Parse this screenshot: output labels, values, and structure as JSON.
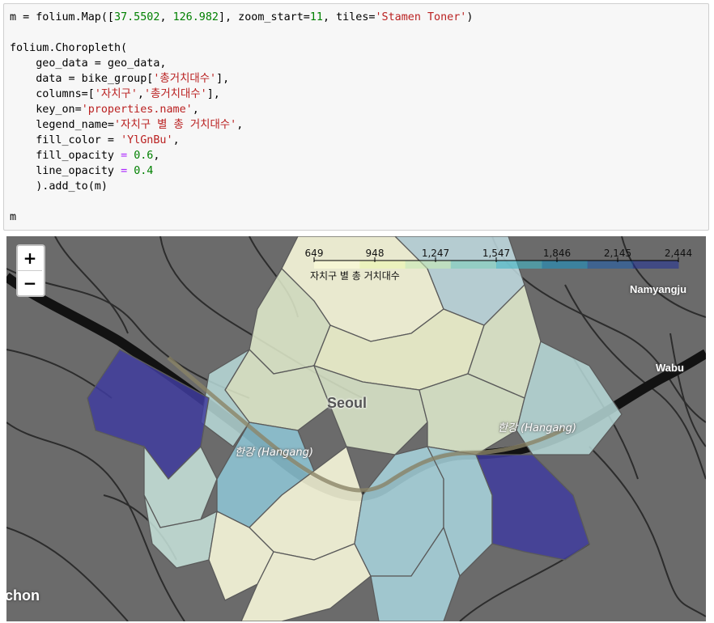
{
  "code_cell": {
    "lines": [
      [
        {
          "t": "m = folium.Map(["
        },
        {
          "t": "37.5502",
          "c": "n"
        },
        {
          "t": ", "
        },
        {
          "t": "126.982",
          "c": "n"
        },
        {
          "t": "], zoom_start="
        },
        {
          "t": "11",
          "c": "n"
        },
        {
          "t": ", tiles="
        },
        {
          "t": "'Stamen Toner'",
          "c": "s"
        },
        {
          "t": ")"
        }
      ],
      [],
      [
        {
          "t": "folium.Choropleth("
        }
      ],
      [
        {
          "t": "    geo_data = geo_data,"
        }
      ],
      [
        {
          "t": "    data = bike_group["
        },
        {
          "t": "'총거치대수'",
          "c": "s"
        },
        {
          "t": "],"
        }
      ],
      [
        {
          "t": "    columns=["
        },
        {
          "t": "'자치구'",
          "c": "s"
        },
        {
          "t": ","
        },
        {
          "t": "'총거치대수'",
          "c": "s"
        },
        {
          "t": "],"
        }
      ],
      [
        {
          "t": "    key_on="
        },
        {
          "t": "'properties.name'",
          "c": "s"
        },
        {
          "t": ","
        }
      ],
      [
        {
          "t": "    legend_name="
        },
        {
          "t": "'자치구 별 총 거치대수'",
          "c": "s"
        },
        {
          "t": ","
        }
      ],
      [
        {
          "t": "    fill_color = "
        },
        {
          "t": "'YlGnBu'",
          "c": "s"
        },
        {
          "t": ","
        }
      ],
      [
        {
          "t": "    fill_opacity "
        },
        {
          "t": "=",
          "c": "k"
        },
        {
          "t": " "
        },
        {
          "t": "0.6",
          "c": "n"
        },
        {
          "t": ","
        }
      ],
      [
        {
          "t": "    line_opacity "
        },
        {
          "t": "=",
          "c": "k"
        },
        {
          "t": " "
        },
        {
          "t": "0.4",
          "c": "n"
        }
      ],
      [
        {
          "t": "    ).add_to(m)"
        }
      ],
      [],
      [
        {
          "t": "m"
        }
      ]
    ]
  },
  "map": {
    "zoom_in_label": "+",
    "zoom_out_label": "−",
    "legend": {
      "title": "자치구 별 총 거치대수",
      "ticks": [
        "649",
        "948",
        "1,247",
        "1,547",
        "1,846",
        "2,145",
        "2,444"
      ],
      "colors": [
        "#ffffd9",
        "#edf8b1",
        "#c7e9b4",
        "#7fcdbb",
        "#41b6c4",
        "#1d91c0",
        "#225ea8",
        "#253494"
      ]
    },
    "places": {
      "seoul": "Seoul",
      "namyangju": "Namyangju",
      "wabu": "Wabu",
      "incheon_partial": "chon"
    },
    "river_labels": {
      "west": "한강 (Hangang)",
      "east": "한강 (Hangang)"
    }
  }
}
